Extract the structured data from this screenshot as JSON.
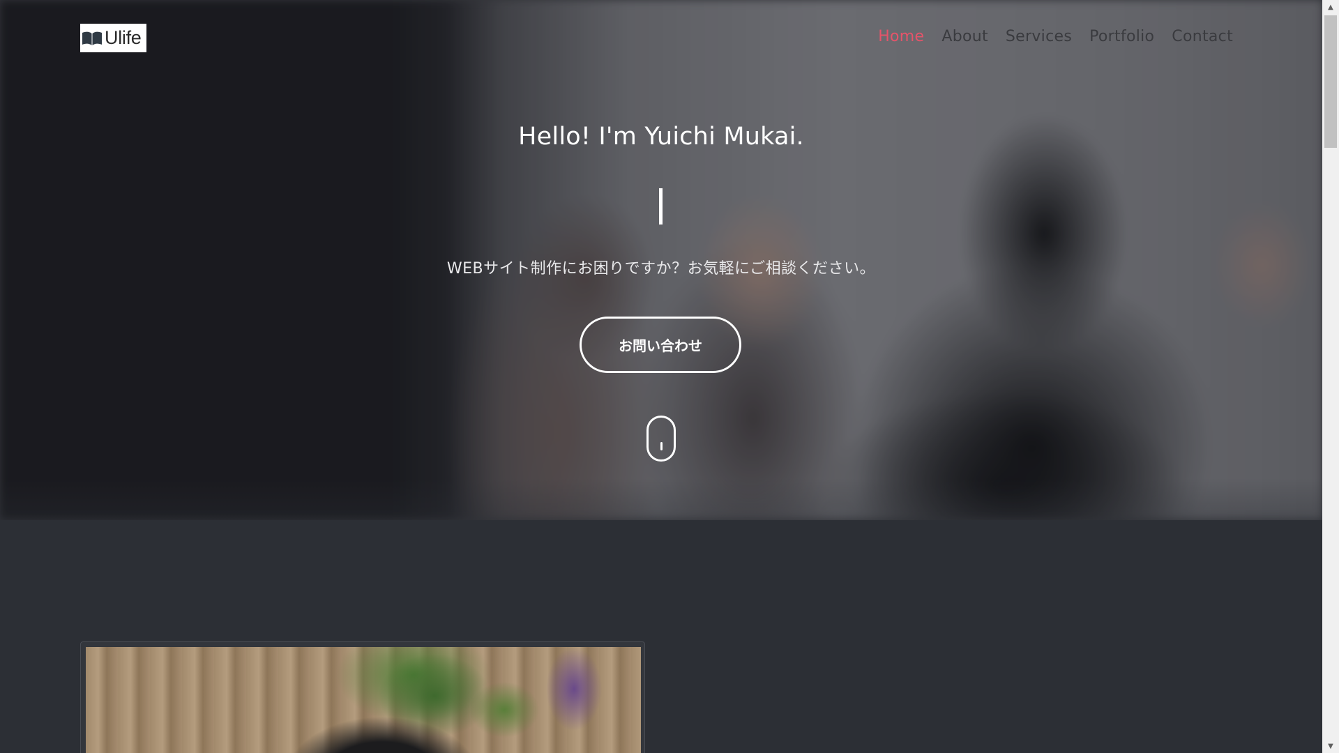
{
  "brand": {
    "logo_text": "Ulife",
    "logo_icon": "open-book-icon"
  },
  "nav": {
    "items": [
      {
        "label": "Home",
        "active": true
      },
      {
        "label": "About",
        "active": false
      },
      {
        "label": "Services",
        "active": false
      },
      {
        "label": "Portfolio",
        "active": false
      },
      {
        "label": "Contact",
        "active": false
      }
    ],
    "active_color": "#e5546a",
    "color": "#3a3b3f"
  },
  "hero": {
    "title": "Hello! I'm Yuichi Mukai.",
    "subtitle": "WEBサイト制作にお困りですか？お気軽にご相談ください。",
    "cta_label": "お問い合わせ",
    "scroll_icon": "mouse-scroll-icon"
  },
  "colors": {
    "about_bg": "#2c2f35",
    "text_light": "#ffffff"
  }
}
